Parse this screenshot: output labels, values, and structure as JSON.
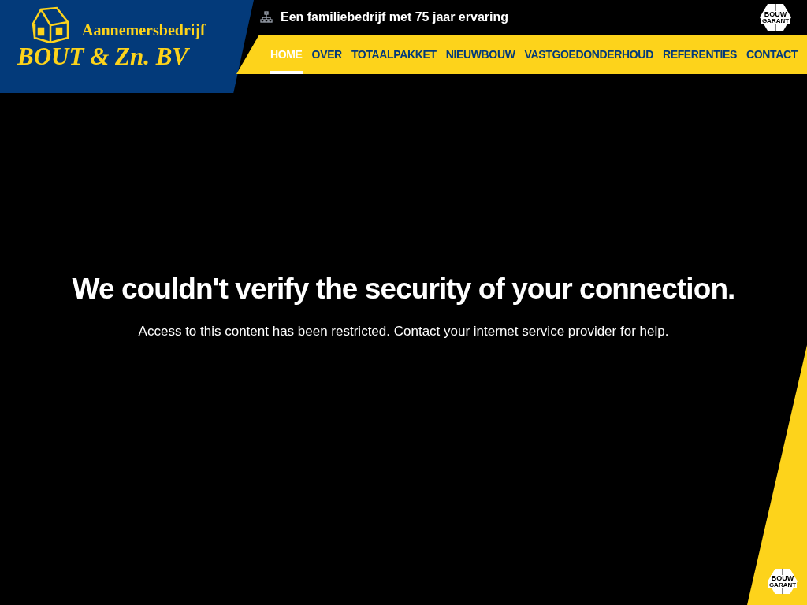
{
  "logo": {
    "subtitle": "Aannemersbedrijf",
    "title": "BOUT & Zn. BV"
  },
  "tagline": "Een familiebedrijf met 75 jaar ervaring",
  "badge_top": {
    "line1": "BOUW",
    "line2": "GARANT"
  },
  "nav": [
    {
      "label": "HOME",
      "selected": true
    },
    {
      "label": "OVER",
      "selected": false
    },
    {
      "label": "TOTAALPAKKET",
      "selected": false
    },
    {
      "label": "NIEUWBOUW",
      "selected": false
    },
    {
      "label": "VASTGOEDONDERHOUD",
      "selected": false
    },
    {
      "label": "REFERENTIES",
      "selected": false
    },
    {
      "label": "CONTACT",
      "selected": false
    }
  ],
  "message": {
    "heading": "We couldn't verify the security of your connection.",
    "body": "Access to this content has been restricted. Contact your internet service provider for help."
  },
  "badge_bottom": {
    "line1": "BOUW",
    "line2": "GARANT"
  }
}
